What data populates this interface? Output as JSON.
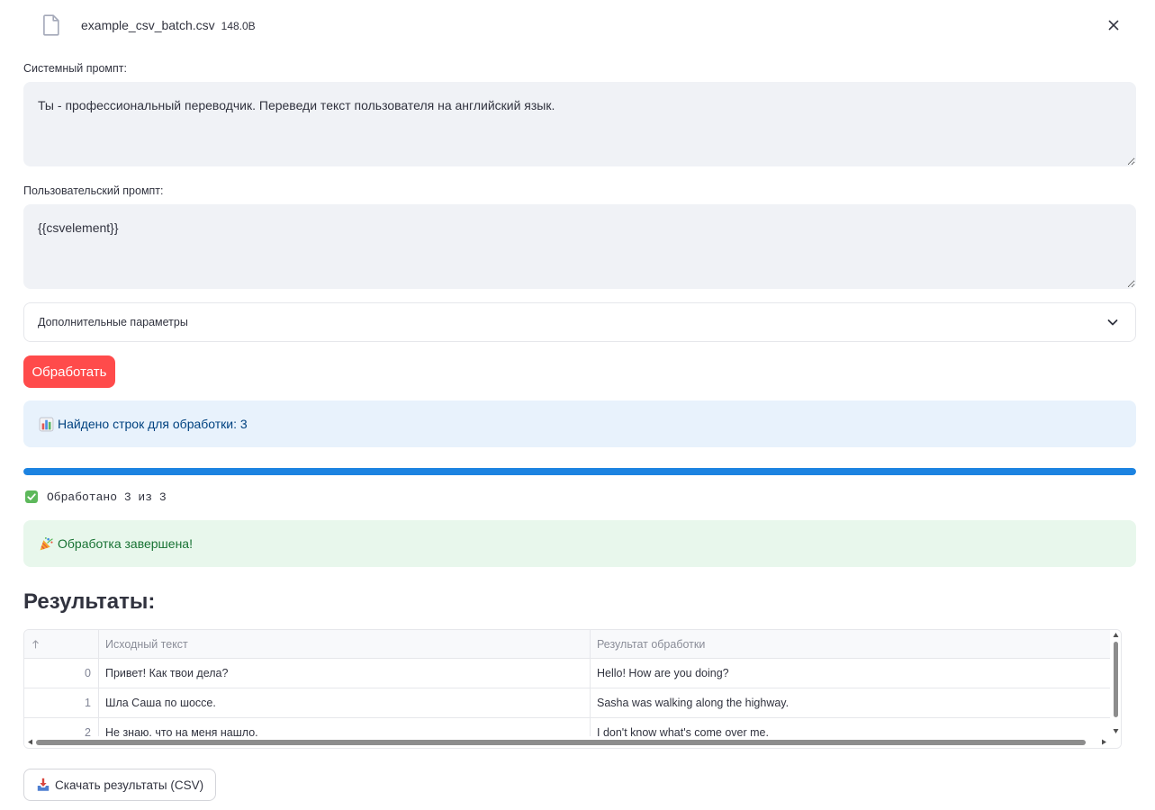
{
  "file": {
    "icon": "file-icon",
    "name": "example_csv_batch.csv",
    "size": "148.0B",
    "remove_icon": "close-icon"
  },
  "system_prompt": {
    "label": "Системный промпт:",
    "value": "Ты - профессиональный переводчик. Переведи текст пользователя на английский язык."
  },
  "user_prompt": {
    "label": "Пользовательский промпт:",
    "value": "{{csvelement}}"
  },
  "advanced": {
    "label": "Дополнительные параметры",
    "expanded": false,
    "icon": "chevron-down-icon"
  },
  "process_button": {
    "label": "Обработать"
  },
  "info": {
    "icon": "bar-chart-icon",
    "text": "Найдено строк для обработки: 3"
  },
  "progress": {
    "value": 1.0,
    "status_icon": "check-mark-icon",
    "status_text": "Обработано 3 из 3"
  },
  "success": {
    "icon": "party-popper-icon",
    "text": "Обработка завершена!"
  },
  "results": {
    "heading": "Результаты:",
    "table": {
      "index_header_icon": "sort-arrow-up-icon",
      "columns": [
        "Исходный текст",
        "Результат обработки"
      ],
      "rows": [
        {
          "index": "0",
          "cells": [
            "Привет! Как твои дела?",
            "Hello! How are you doing?"
          ]
        },
        {
          "index": "1",
          "cells": [
            "Шла Саша по шоссе.",
            "Sasha was walking along the highway."
          ]
        },
        {
          "index": "2",
          "cells": [
            "Не знаю, что на меня нашло.",
            "I don't know what's come over me."
          ]
        }
      ]
    }
  },
  "download_button": {
    "icon": "inbox-tray-icon",
    "label": "Скачать результаты (CSV)"
  },
  "colors": {
    "primary": "#ff4b4b",
    "progress": "#1c83e1",
    "info_bg": "#e8f2fc",
    "info_text": "#004280",
    "success_bg": "#e8f7ec",
    "success_text": "#177233",
    "text": "#31333f",
    "input_bg": "#f0f2f6",
    "muted": "#808495",
    "border": "#e6e7eb"
  }
}
